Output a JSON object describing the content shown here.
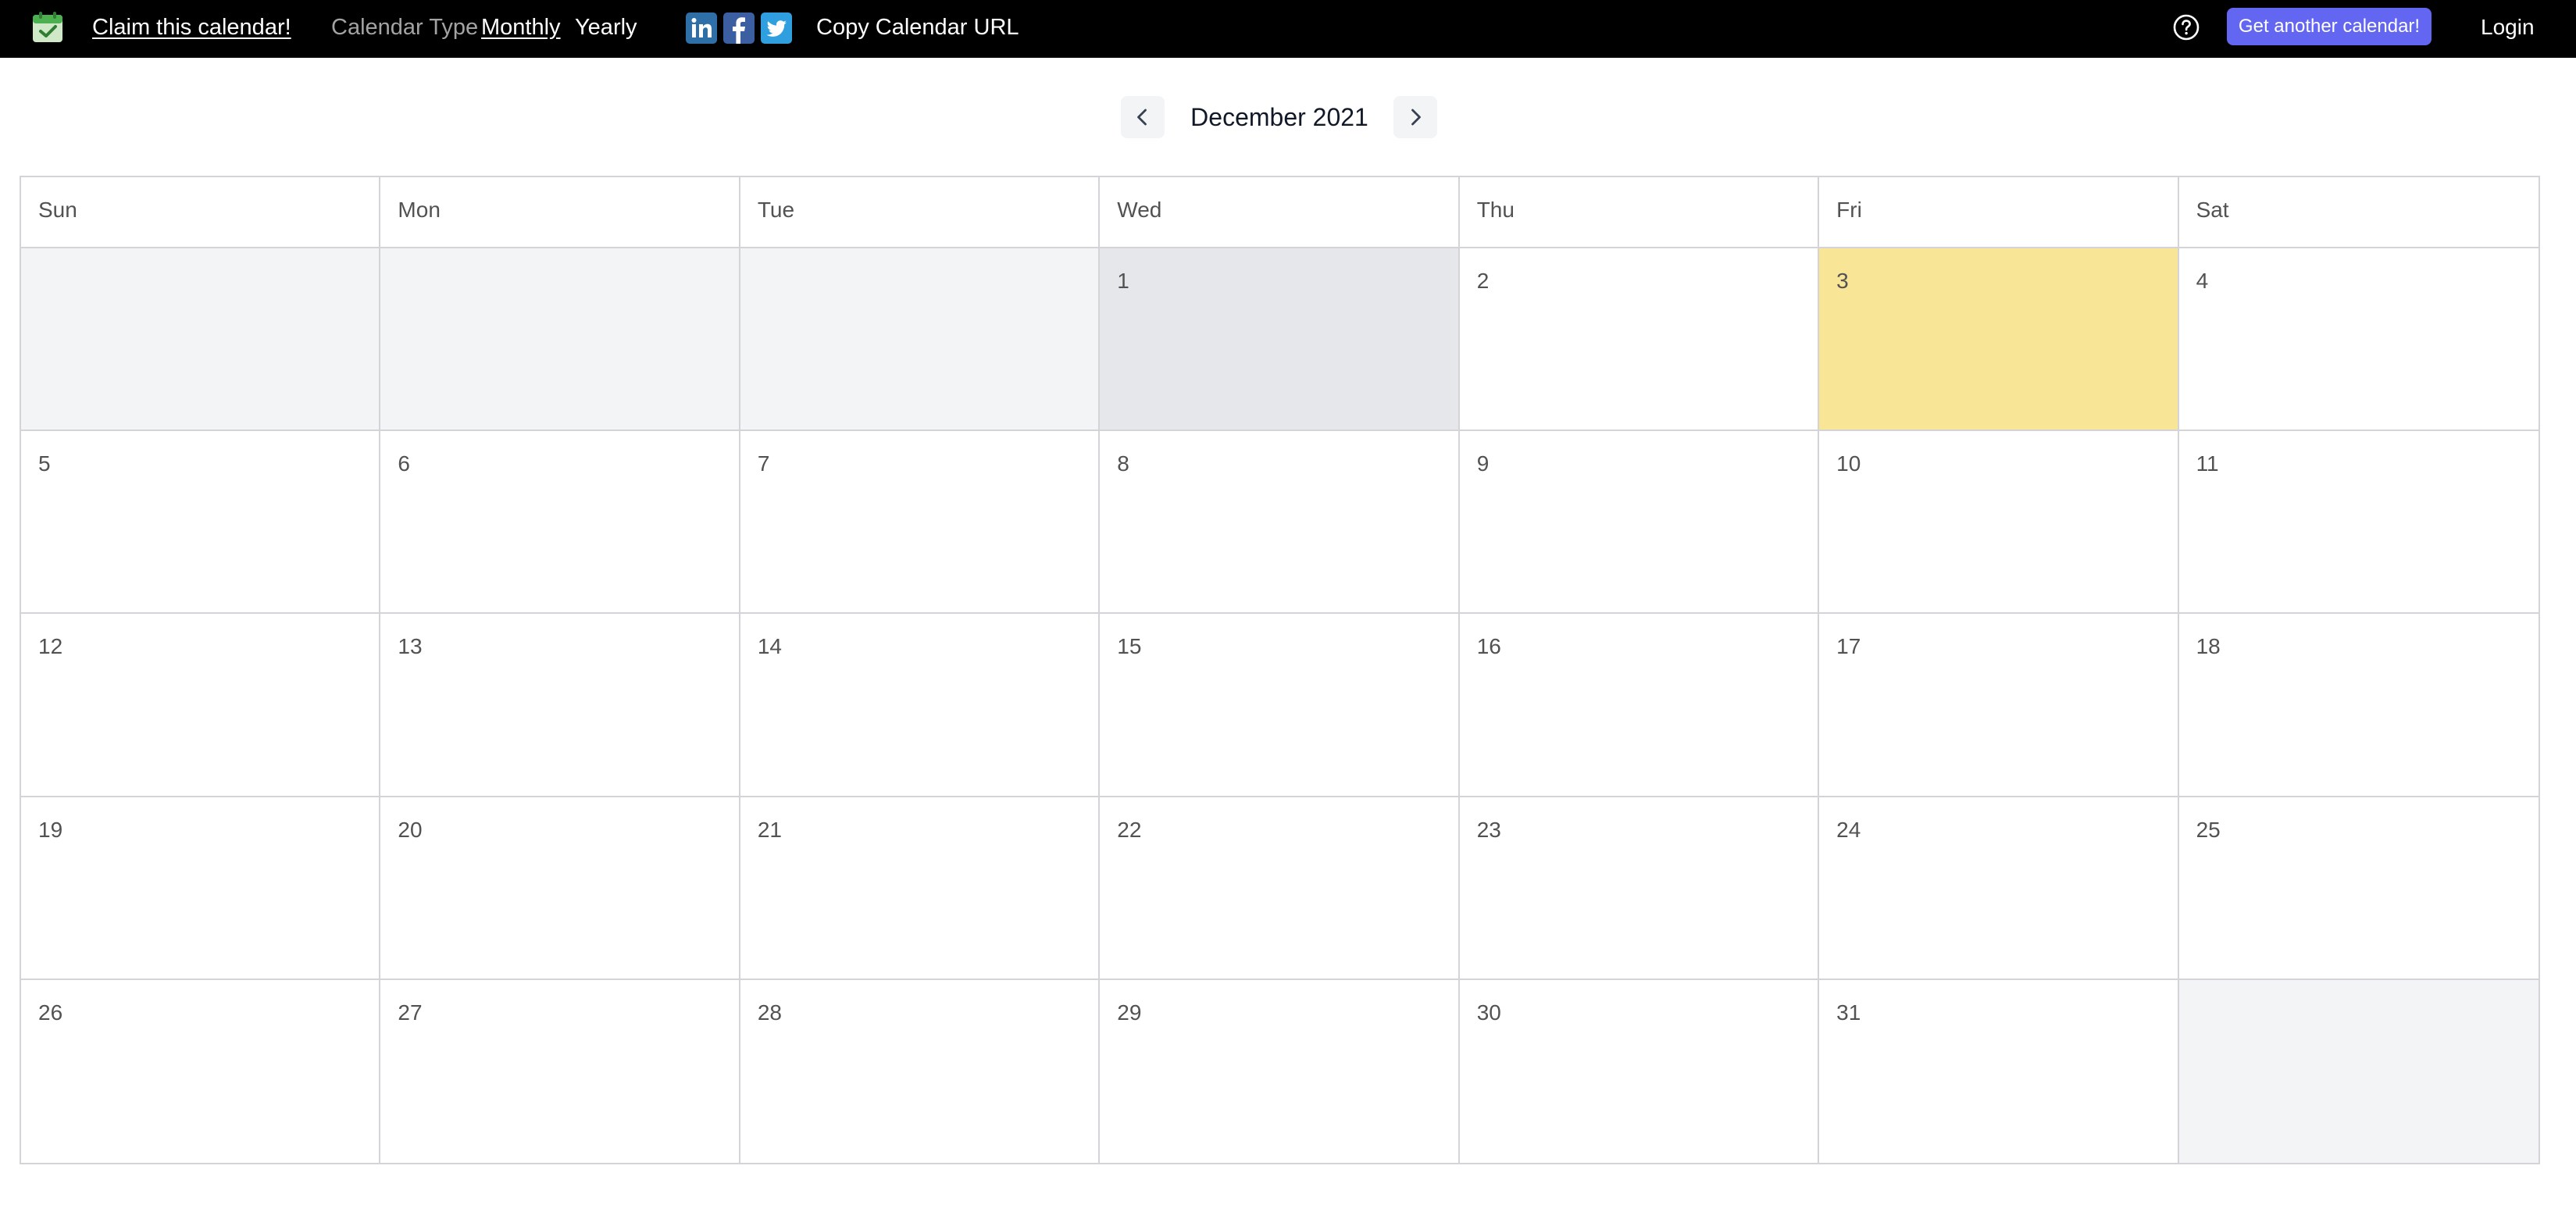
{
  "header": {
    "claim_label": "Claim this calendar!",
    "calendar_type_label": "Calendar Type",
    "monthly_label": "Monthly",
    "yearly_label": "Yearly",
    "social": [
      {
        "icon": "linkedin-icon",
        "color": "#2f6fa8"
      },
      {
        "icon": "facebook-icon",
        "color": "#3b5fa1"
      },
      {
        "icon": "twitter-icon",
        "color": "#2f9fe0"
      }
    ],
    "copy_url_label": "Copy Calendar URL",
    "help_icon": "question-circle-icon",
    "another_label": "Get another calendar!",
    "login_label": "Login"
  },
  "nav": {
    "title": "December 2021",
    "prev_icon": "chevron-left-icon",
    "next_icon": "chevron-right-icon"
  },
  "calendar": {
    "weekdays": [
      "Sun",
      "Mon",
      "Tue",
      "Wed",
      "Thu",
      "Fri",
      "Sat"
    ],
    "leading_empty": 3,
    "days_in_month": 31,
    "selected_day": 1,
    "today_day": 3
  },
  "colors": {
    "accent": "#6366f1",
    "today": "#f9e596",
    "selected": "#e5e7eb",
    "empty": "#f3f4f6",
    "grid_line": "#d4d4d8"
  }
}
